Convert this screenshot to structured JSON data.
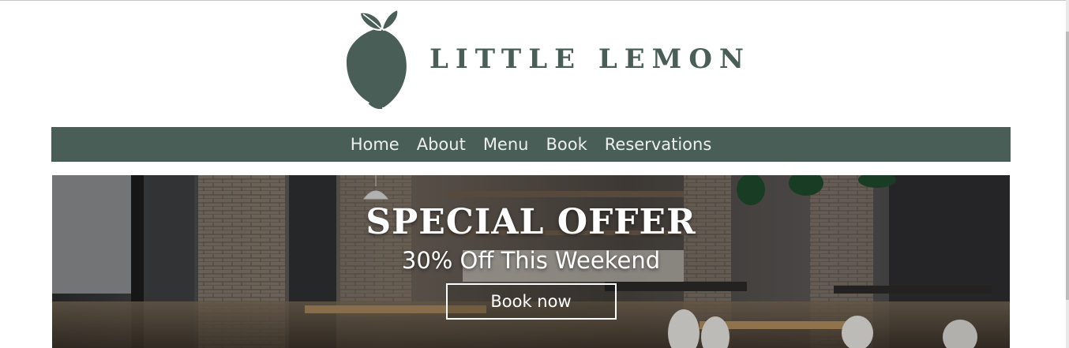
{
  "brand": {
    "name": "LITTLE LEMON",
    "color": "#495e57"
  },
  "nav": {
    "items": [
      {
        "label": "Home"
      },
      {
        "label": "About"
      },
      {
        "label": "Menu"
      },
      {
        "label": "Book"
      },
      {
        "label": "Reservations"
      }
    ]
  },
  "hero": {
    "title": "SPECIAL OFFER",
    "subtitle": "30% Off This Weekend",
    "cta_label": "Book now"
  }
}
